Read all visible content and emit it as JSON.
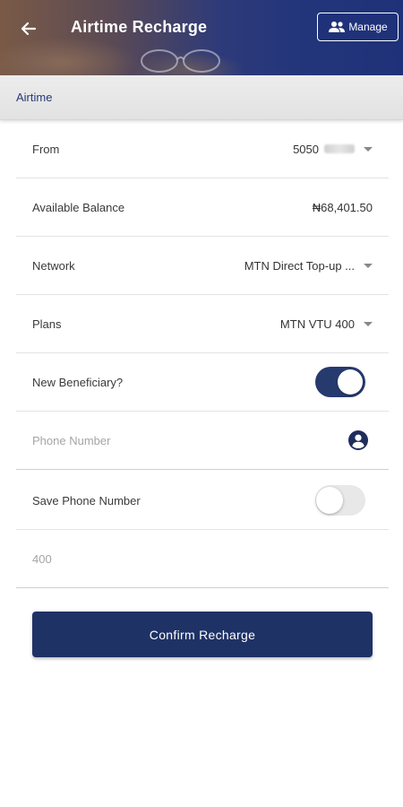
{
  "header": {
    "title": "Airtime Recharge",
    "manage_label": "Manage"
  },
  "section": {
    "title": "Airtime"
  },
  "form": {
    "from": {
      "label": "From",
      "value": "5050"
    },
    "balance": {
      "label": "Available Balance",
      "value": "₦68,401.50"
    },
    "network": {
      "label": "Network",
      "value": "MTN Direct Top-up ..."
    },
    "plans": {
      "label": "Plans",
      "value": "MTN VTU 400"
    },
    "new_beneficiary": {
      "label": "New Beneficiary?",
      "enabled": true
    },
    "phone": {
      "placeholder": "Phone Number",
      "value": ""
    },
    "save_phone": {
      "label": "Save Phone Number",
      "enabled": false
    },
    "amount": {
      "placeholder": "400",
      "value": ""
    }
  },
  "confirm_label": "Confirm Recharge",
  "colors": {
    "primary": "#1f3266",
    "toggle_on": "#263a6e"
  }
}
